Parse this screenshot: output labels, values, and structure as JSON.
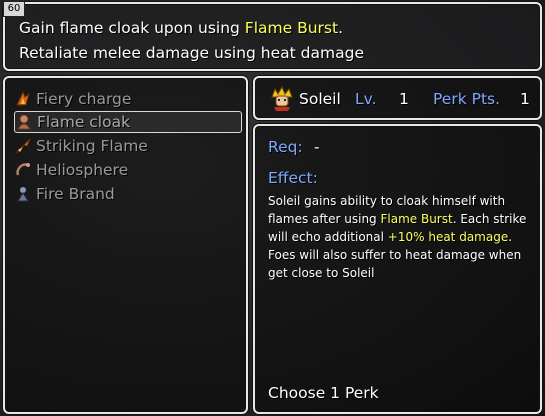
{
  "level_badge": "60",
  "description": {
    "line1_pre": "Gain flame cloak upon using ",
    "line1_highlight": "Flame Burst",
    "line1_post": ".",
    "line2": "Retaliate melee damage using heat damage"
  },
  "perks": [
    {
      "label": "Fiery charge",
      "icon": "fiery-charge-icon",
      "selected": false
    },
    {
      "label": "Flame cloak",
      "icon": "flame-cloak-icon",
      "selected": true
    },
    {
      "label": "Striking Flame",
      "icon": "striking-flame-icon",
      "selected": false
    },
    {
      "label": "Heliosphere",
      "icon": "heliosphere-icon",
      "selected": false
    },
    {
      "label": "Fire Brand",
      "icon": "fire-brand-icon",
      "selected": false
    }
  ],
  "character": {
    "name": "Soleil",
    "lv_label": "Lv.",
    "lv_value": "1",
    "pts_label": "Perk Pts.",
    "pts_value": "1"
  },
  "detail": {
    "req_label": "Req:",
    "req_value": "-",
    "effect_label": "Effect:",
    "effect_1": "Soleil gains ability to cloak himself with flames after using ",
    "effect_hl1": "Flame Burst",
    "effect_2": ". Each strike will echo additional ",
    "effect_hl2": "+10% heat damage",
    "effect_3": ". Foes will also suffer to heat damage when get close to Soleil",
    "choose": "Choose 1 Perk"
  },
  "colors": {
    "label_blue": "#7fa8ff",
    "highlight_yellow": "#ffff60",
    "disabled_gray": "#9a9a9a"
  }
}
